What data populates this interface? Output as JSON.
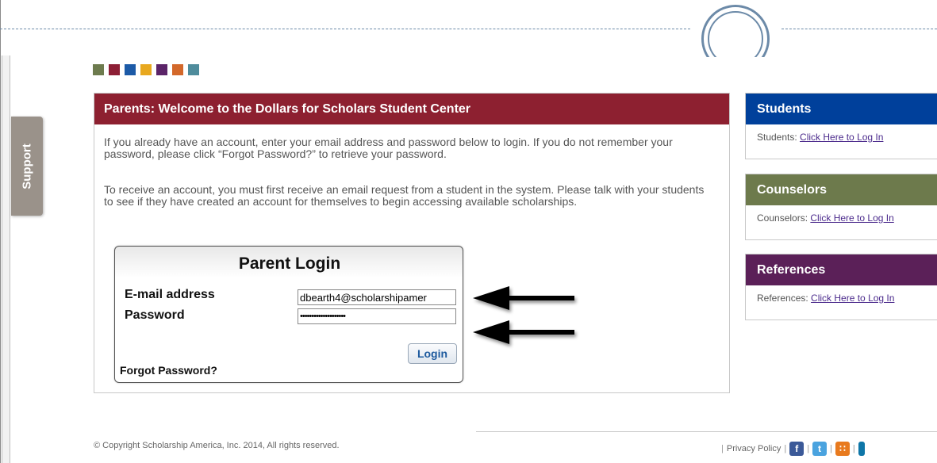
{
  "support": {
    "label": "Support"
  },
  "brand_colors": [
    "#6d7b4e",
    "#8d1f35",
    "#1c5aa7",
    "#e8a81f",
    "#5b2468",
    "#d3682a",
    "#4f8c9c"
  ],
  "main": {
    "title": "Parents: Welcome to the Dollars for Scholars Student Center",
    "para1": "If you already have an account, enter your email address and password below to login.  If you do not remember your password, please click “Forgot Password?” to retrieve your password.",
    "para2": "To receive an account, you must first receive an email request from a student in the system. Please talk with your students to see if they have created an account for themselves to begin accessing available scholarships."
  },
  "login": {
    "title": "Parent Login",
    "email_label": "E-mail address",
    "email_value": "dbearth4@scholarshipamer",
    "password_label": "Password",
    "password_value": "••••••••••••••••••••",
    "login_button": "Login",
    "forgot_link": "Forgot Password?"
  },
  "side": {
    "students": {
      "title": "Students",
      "prefix": "Students: ",
      "link": "Click Here to Log In",
      "color": "#00409b"
    },
    "counselors": {
      "title": "Counselors",
      "prefix": "Counselors: ",
      "link": "Click Here to Log In",
      "color": "#6d7a4c"
    },
    "references": {
      "title": "References",
      "prefix": "References: ",
      "link": "Click Here to Log In",
      "color": "#5b2058"
    }
  },
  "footer": {
    "copyright": "© Copyright Scholarship America, Inc. 2014, All rights reserved.",
    "privacy": "Privacy Policy"
  },
  "social_icons": [
    "facebook-icon",
    "twitter-icon",
    "rss-icon",
    "linkedin-icon"
  ]
}
